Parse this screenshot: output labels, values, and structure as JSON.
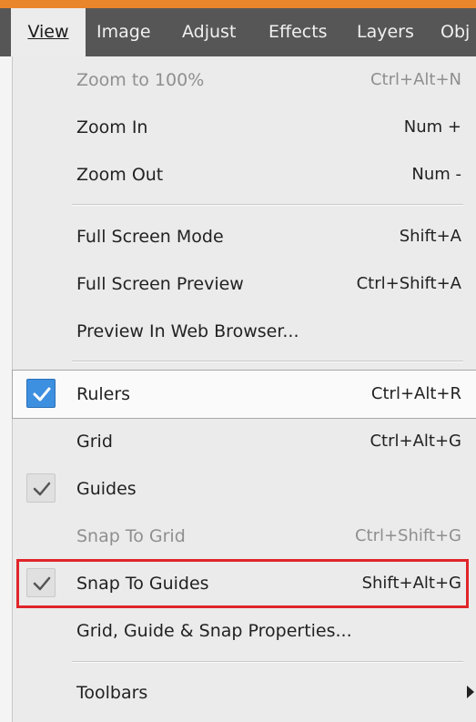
{
  "menubar": {
    "items": [
      {
        "label": "View",
        "active": true
      },
      {
        "label": "Image"
      },
      {
        "label": "Adjust"
      },
      {
        "label": "Effects"
      },
      {
        "label": "Layers"
      },
      {
        "label": "Obj"
      }
    ]
  },
  "menu": {
    "zoom_100": {
      "label": "Zoom to 100%",
      "shortcut": "Ctrl+Alt+N",
      "disabled": true
    },
    "zoom_in": {
      "label": "Zoom In",
      "shortcut": "Num +"
    },
    "zoom_out": {
      "label": "Zoom Out",
      "shortcut": "Num -"
    },
    "full_screen_mode": {
      "label": "Full Screen Mode",
      "shortcut": "Shift+A"
    },
    "full_screen_preview": {
      "label": "Full Screen Preview",
      "shortcut": "Ctrl+Shift+A"
    },
    "preview_web": {
      "label": "Preview In Web Browser..."
    },
    "rulers": {
      "label": "Rulers",
      "shortcut": "Ctrl+Alt+R",
      "checked": true,
      "highlighted": true
    },
    "grid": {
      "label": "Grid",
      "shortcut": "Ctrl+Alt+G",
      "checked": false
    },
    "guides": {
      "label": "Guides",
      "checked": true
    },
    "snap_grid": {
      "label": "Snap To Grid",
      "shortcut": "Ctrl+Shift+G",
      "disabled": true
    },
    "snap_guides": {
      "label": "Snap To Guides",
      "shortcut": "Shift+Alt+G",
      "checked": true
    },
    "grid_props": {
      "label": "Grid, Guide & Snap Properties..."
    },
    "toolbars": {
      "label": "Toolbars",
      "has_submenu": true
    }
  },
  "colors": {
    "highlight_box": "#e0252a",
    "check_active": "#3d8fe0",
    "menubar": "#565656",
    "accent": "#e9852b"
  }
}
